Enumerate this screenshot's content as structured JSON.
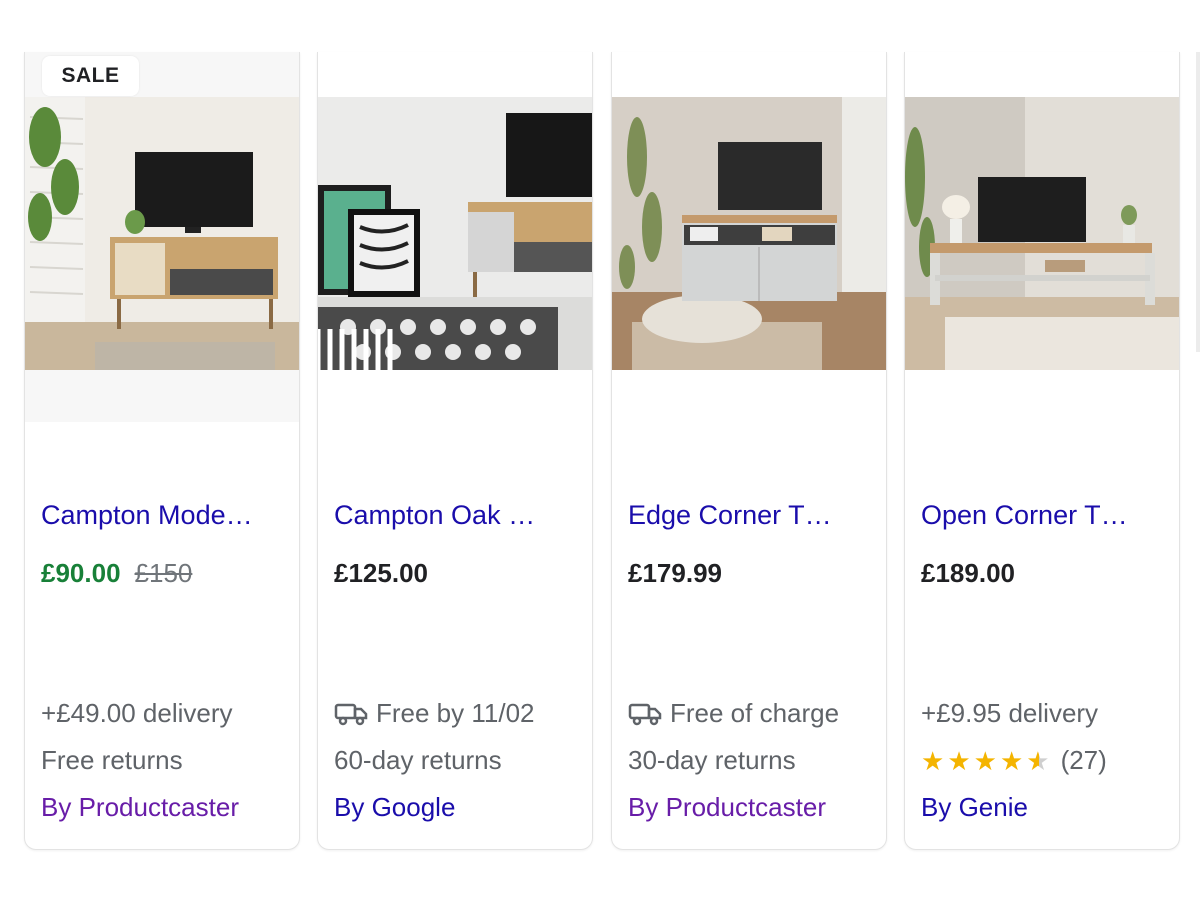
{
  "products": [
    {
      "badge": "SALE",
      "title": "Campton Mode…",
      "price": "£90.00",
      "old_price": "£150",
      "line1": "+£49.00 delivery",
      "line2": "Free returns",
      "seller": "By Productcaster"
    },
    {
      "title": "Campton Oak …",
      "price": "£125.00",
      "line1": "Free by 11/02",
      "line2": "60-day returns",
      "seller": "By Google"
    },
    {
      "title": "Edge Corner T…",
      "price": "£179.99",
      "line1": "Free of charge",
      "line2": "30-day returns",
      "seller": "By Productcaster"
    },
    {
      "title": "Open Corner T…",
      "price": "£189.00",
      "line1": "+£9.95 delivery",
      "rating": 4.5,
      "rating_count": "(27)",
      "seller": "By Genie"
    }
  ],
  "icons": {
    "delivery": "truck-icon",
    "rating": "star-icon"
  },
  "colors": {
    "link": "#1a0dab",
    "sale_price": "#188038",
    "seller_purple": "#681da8",
    "star": "#f4b400",
    "secondary_text": "#5f6368"
  }
}
